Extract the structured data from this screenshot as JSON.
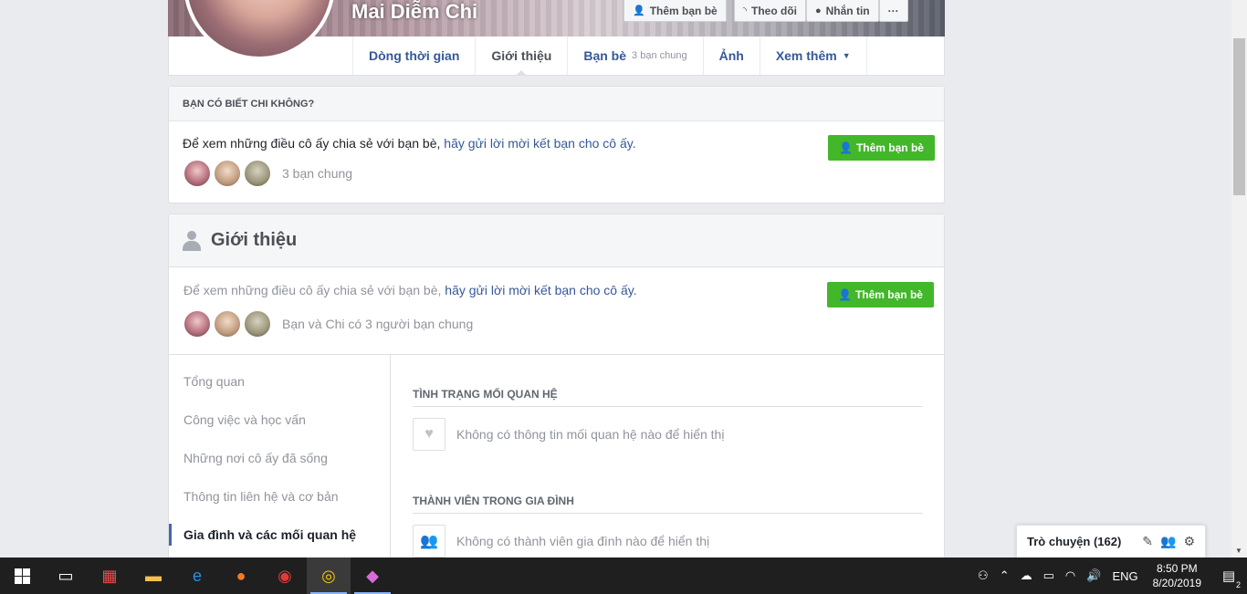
{
  "profile": {
    "name": "Mai Diễm Chi"
  },
  "cover_actions": {
    "add_friend": "Thêm bạn bè",
    "follow": "Theo dõi",
    "message": "Nhắn tin",
    "more": "···"
  },
  "tabs": [
    {
      "label": "Dòng thời gian",
      "sub": ""
    },
    {
      "label": "Giới thiệu",
      "sub": ""
    },
    {
      "label": "Bạn bè",
      "sub": "3 bạn chung"
    },
    {
      "label": "Ảnh",
      "sub": ""
    },
    {
      "label": "Xem thêm",
      "sub": ""
    }
  ],
  "know_card": {
    "heading": "BẠN CÓ BIẾT CHI KHÔNG?",
    "text_plain": "Để xem những điều cô ấy chia sẻ với bạn bè, ",
    "text_link": "hãy gửi lời mời kết bạn cho cô ấy.",
    "mutual": "3 bạn chung",
    "button": "Thêm bạn bè"
  },
  "intro_card": {
    "title": "Giới thiệu",
    "text_plain": "Để xem những điều cô ấy chia sẻ với bạn bè, ",
    "text_link": "hãy gửi lời mời kết bạn cho cô ấy.",
    "mutual": "Bạn và Chi có 3 người bạn chung",
    "button": "Thêm bạn bè"
  },
  "side_nav": [
    {
      "label": "Tổng quan",
      "active": false
    },
    {
      "label": "Công việc và học vấn",
      "active": false
    },
    {
      "label": "Những nơi cô ấy đã sống",
      "active": false
    },
    {
      "label": "Thông tin liên hệ và cơ bản",
      "active": false
    },
    {
      "label": "Gia đình và các mối quan hệ",
      "active": true
    }
  ],
  "sections": {
    "relationship": {
      "title": "TÌNH TRẠNG MỐI QUAN HỆ",
      "empty": "Không có thông tin mối quan hệ nào để hiển thị"
    },
    "family": {
      "title": "THÀNH VIÊN TRONG GIA ĐÌNH",
      "empty": "Không có thành viên gia đình nào để hiển thị"
    }
  },
  "chat": {
    "label": "Trò chuyện (162)"
  },
  "taskbar": {
    "language": "ENG",
    "time": "8:50 PM",
    "date": "8/20/2019",
    "notifications": "2"
  },
  "colors": {
    "link": "#365899",
    "green": "#42b72a",
    "background": "#e9ebee"
  }
}
